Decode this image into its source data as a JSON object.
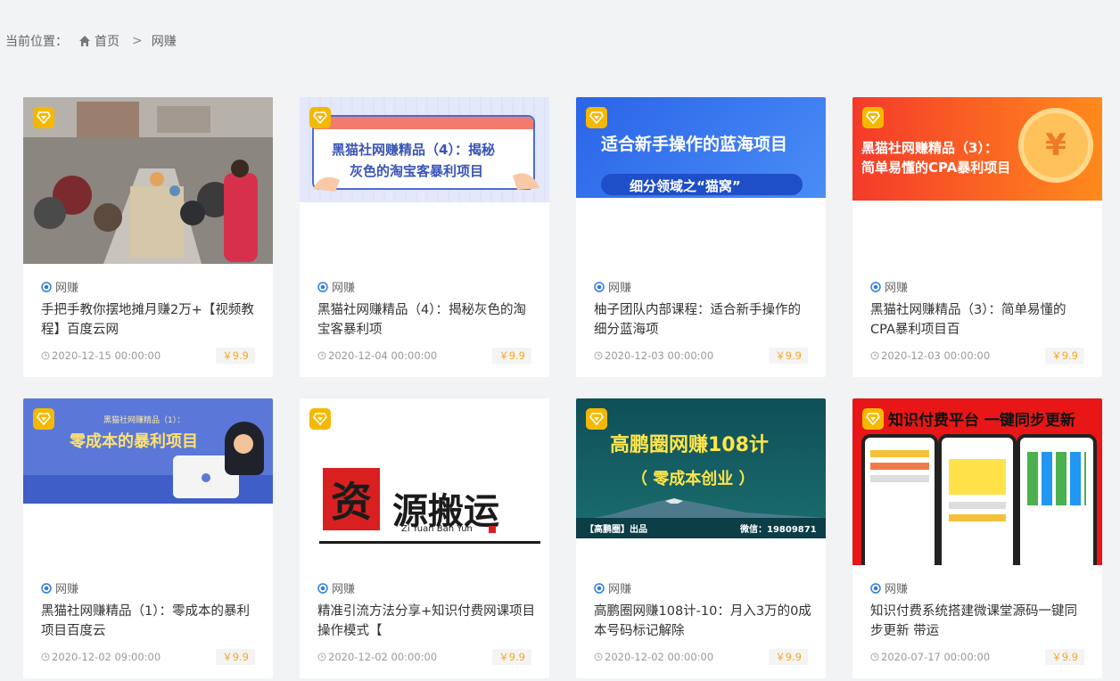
{
  "breadcrumb": {
    "prefix": "当前位置：",
    "home": "首页",
    "separator": ">",
    "current": "网赚"
  },
  "colors": {
    "accent": "#f5b800",
    "price": "#f6a623",
    "category_icon": "#2f7de1",
    "background": "#f1f3f5"
  },
  "cards": [
    {
      "category": "网赚",
      "title": "手把手教你摆地摊月赚2万+【视频教程】百度云网",
      "date": "2020-12-15 00:00:00",
      "price": "￥9.9",
      "thumb": {
        "kind": "photo"
      }
    },
    {
      "category": "网赚",
      "title": "黑猫社网赚精品（4）：揭秘灰色的淘宝客暴利项",
      "date": "2020-12-04 00:00:00",
      "price": "￥9.9",
      "thumb": {
        "line1": "黑猫社网赚精品（4）：揭秘",
        "line2": "灰色的淘宝客暴利项目"
      }
    },
    {
      "category": "网赚",
      "title": "柚子团队内部课程：适合新手操作的细分蓝海项",
      "date": "2020-12-03 00:00:00",
      "price": "￥9.9",
      "thumb": {
        "line1": "适合新手操作的蓝海项目",
        "line2": "细分领域之“猫窝”"
      }
    },
    {
      "category": "网赚",
      "title": "黑猫社网赚精品（3）：简单易懂的CPA暴利项目百",
      "date": "2020-12-03 00:00:00",
      "price": "￥9.9",
      "thumb": {
        "line1": "黑猫社网赚精品（3）：",
        "line2": "简单易懂的CPA暴利项目",
        "coin": "¥"
      }
    },
    {
      "category": "网赚",
      "title": "黑猫社网赚精品（1）：零成本的暴利项目百度云",
      "date": "2020-12-02 09:00:00",
      "price": "￥9.9",
      "thumb": {
        "line1": "黑猫社网赚精品（1）：",
        "line2": "零成本的暴利项目"
      }
    },
    {
      "category": "网赚",
      "title": "精准引流方法分享+知识付费网课项目操作模式【",
      "date": "2020-12-02 00:00:00",
      "price": "￥9.9",
      "thumb": {
        "seal": "资",
        "brush": "源搬运",
        "pinyin": "Zi Yuan Ban Yun"
      }
    },
    {
      "category": "网赚",
      "title": "高鹏圈网赚108计-10：月入3万的0成本号码标记解除",
      "date": "2020-12-02 00:00:00",
      "price": "￥9.9",
      "thumb": {
        "line1": "高鹏圈网赚108计",
        "line2": "（ 零成本创业 ）",
        "footer_left": "【高鹏圈】出品",
        "footer_right": "微信：19809871"
      }
    },
    {
      "category": "网赚",
      "title": "知识付费系统搭建微课堂源码一键同步更新 带运",
      "date": "2020-07-17 00:00:00",
      "price": "￥9.9",
      "thumb": {
        "line1": "知识付费平台 一键同步更新"
      }
    }
  ]
}
